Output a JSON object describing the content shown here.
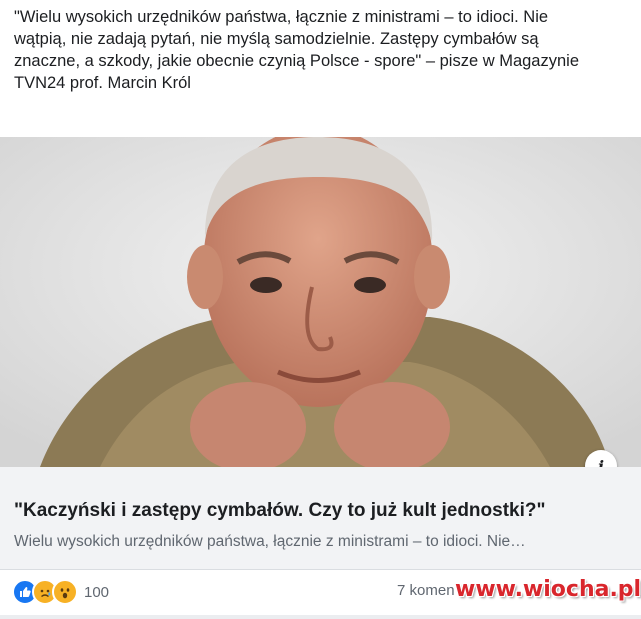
{
  "post": {
    "text": "\"Wielu wysokich urzędników państwa, łącznie z ministrami – to idioci. Nie wątpią, nie zadają pytań, nie myślą samodzielnie. Zastępy cymbałów są znaczne, a szkody, jakie obecnie czynią Polsce - spore\" – pisze w Magazynie TVN24 prof. Marcin Król"
  },
  "link_preview": {
    "info_icon": "i",
    "title": "\"Kaczyński i zastępy cymbałów. Czy to już kult jednostki?\"",
    "description": "Wielu wysokich urzędników państwa, łącznie z ministrami – to idioci. Nie…"
  },
  "footer": {
    "reaction_icons": [
      "like-icon",
      "sad-icon",
      "wow-icon"
    ],
    "reaction_count": "100",
    "comments_text": "7 komen"
  },
  "watermark": "www.wiocha.pl",
  "colors": {
    "reaction_like": "#1877f2",
    "reaction_emoji": "#f7b125",
    "watermark": "#d9262c"
  }
}
